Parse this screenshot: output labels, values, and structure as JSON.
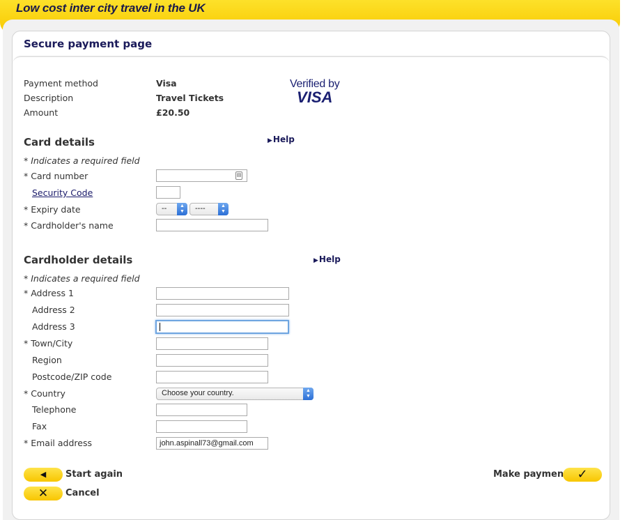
{
  "header": {
    "tagline": "Low cost inter city travel in the UK"
  },
  "page": {
    "title": "Secure payment page"
  },
  "summary": {
    "payment_method_label": "Payment method",
    "payment_method_value": "Visa",
    "description_label": "Description",
    "description_value": "Travel Tickets",
    "amount_label": "Amount",
    "amount_value": "£20.50"
  },
  "visa_logo": {
    "line1": "Verified by",
    "line2": "VISA"
  },
  "card_details": {
    "heading": "Card details",
    "help": "Help",
    "required_note": "* Indicates a required field",
    "card_number_label": "* Card number",
    "security_code_label": "Security Code",
    "expiry_label": "* Expiry date",
    "expiry_month": "--",
    "expiry_year": "----",
    "cardholder_name_label": "* Cardholder's name"
  },
  "cardholder_details": {
    "heading": "Cardholder details",
    "help": "Help",
    "required_note": "* Indicates a required field",
    "address1_label": "* Address 1",
    "address2_label": "Address 2",
    "address3_label": "Address 3",
    "town_label": "* Town/City",
    "region_label": "Region",
    "postcode_label": "Postcode/ZIP code",
    "country_label": "* Country",
    "country_value": "Choose your country.",
    "telephone_label": "Telephone",
    "fax_label": "Fax",
    "email_label": "* Email address",
    "email_value": "john.aspinall73@gmail.com"
  },
  "actions": {
    "start_again_label": "Start again",
    "cancel_label": "Cancel",
    "make_payment_label": "Make payment"
  },
  "icons": {
    "back": "arrow-left-icon",
    "cancel": "x-icon",
    "confirm": "checkmark-icon",
    "help": "triangle-right-icon"
  },
  "colors": {
    "accent_yellow": "#f8c900",
    "heading_navy": "#1a1a5a",
    "focus_blue": "#6ea5e0"
  }
}
